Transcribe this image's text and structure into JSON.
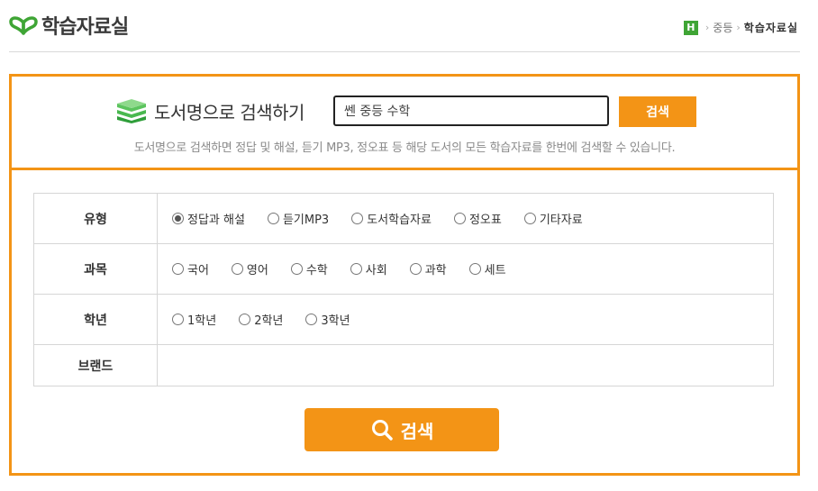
{
  "header": {
    "logo_text": "학습자료실",
    "breadcrumb": {
      "badge": "H",
      "level": "중등",
      "current": "학습자료실"
    }
  },
  "search": {
    "title": "도서명으로 검색하기",
    "input_value": "쎈 중등 수학",
    "button_label": "검색",
    "description": "도서명으로 검색하면 정답 및 해설, 듣기 MP3, 정오표 등 해당 도서의 모든 학습자료를 한번에 검색할 수 있습니다."
  },
  "filters": {
    "type": {
      "label": "유형",
      "options": [
        "정답과 해설",
        "듣기MP3",
        "도서학습자료",
        "정오표",
        "기타자료"
      ],
      "selected_index": 0
    },
    "subject": {
      "label": "과목",
      "options": [
        "국어",
        "영어",
        "수학",
        "사회",
        "과학",
        "세트"
      ]
    },
    "grade": {
      "label": "학년",
      "options": [
        "1학년",
        "2학년",
        "3학년"
      ]
    },
    "brand": {
      "label": "브랜드"
    }
  },
  "main_search_label": "검색",
  "colors": {
    "accent": "#f39416",
    "logo_green": "#3fa535"
  },
  "icons": {
    "logo": "open-book-leaf-icon",
    "books": "stacked-books-icon",
    "search": "magnifier-icon"
  }
}
